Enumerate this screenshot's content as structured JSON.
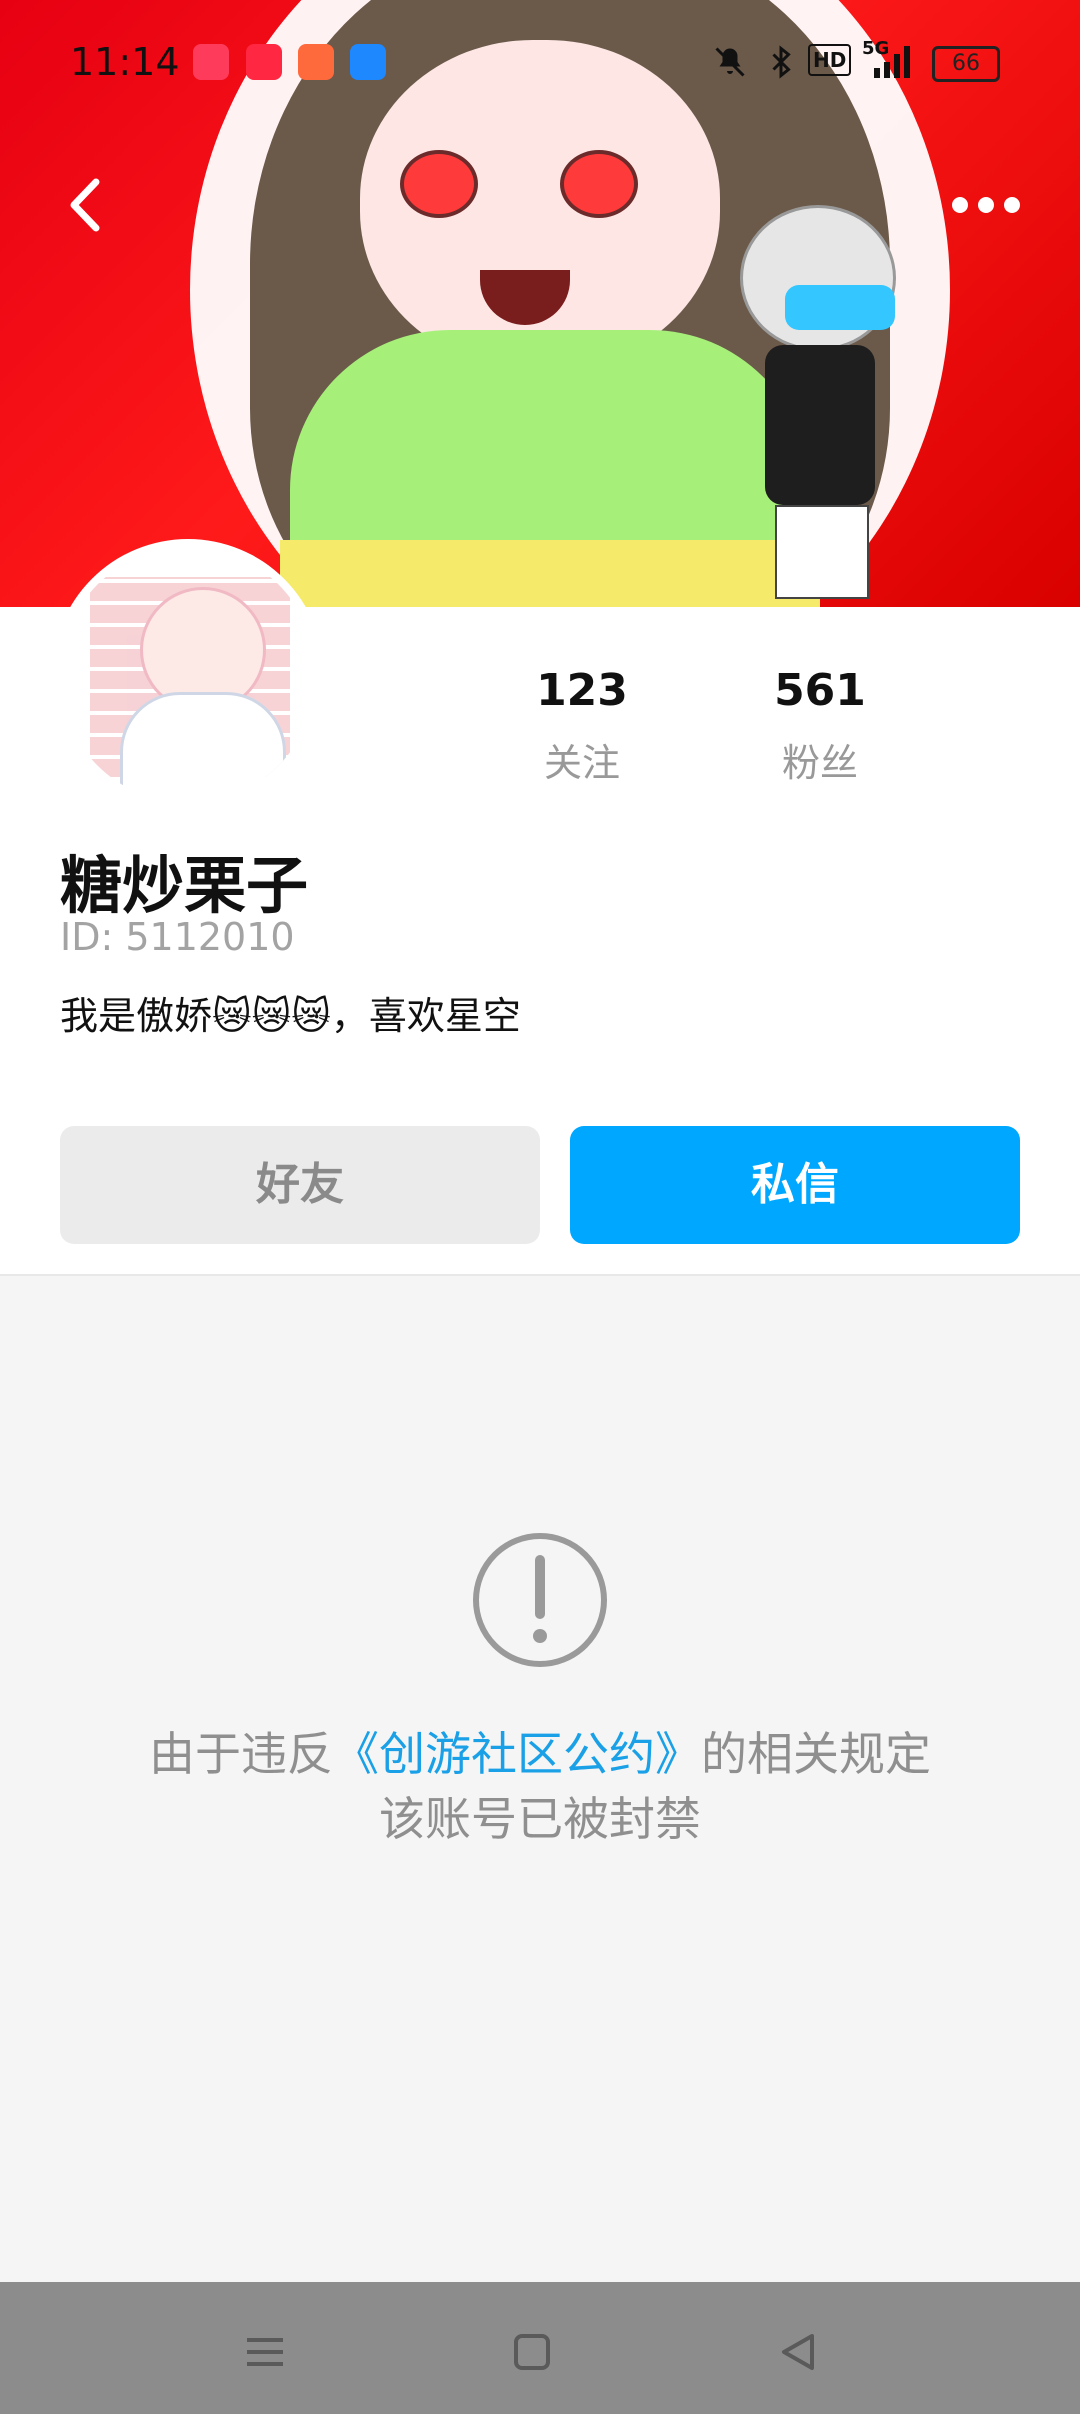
{
  "status_bar": {
    "time": "11:14",
    "network": "5G",
    "hd_label": "HD",
    "battery": "66",
    "notification_apps": [
      {
        "icon": "video-app-icon",
        "color": "#ff3b5c"
      },
      {
        "icon": "heart-app-icon",
        "color": "#ff2741"
      },
      {
        "icon": "game-app-icon",
        "color": "#ff6a3d"
      },
      {
        "icon": "files-app-icon",
        "color": "#1e88ff"
      }
    ]
  },
  "header": {
    "back_icon": "chevron-left-icon",
    "more_icon": "more-horizontal-icon"
  },
  "profile": {
    "stats": {
      "following_count": "123",
      "following_label": "关注",
      "followers_count": "561",
      "followers_label": "粉丝"
    },
    "name": "糖炒栗子",
    "id_text": "ID: 5112010",
    "bio": "我是傲娇😿😿😿，喜欢星空"
  },
  "actions": {
    "friend_label": "好友",
    "message_label": "私信"
  },
  "ban_notice": {
    "icon": "exclamation-circle-icon",
    "line1_prefix": "由于违反",
    "line1_link": "《创游社区公约》",
    "line1_suffix": "的相关规定",
    "line2": "该账号已被封禁"
  },
  "colors": {
    "accent": "#00a7ff",
    "link": "#1aa0e6",
    "banner_red": "#e60012",
    "nav_bg": "#8c8c8c"
  },
  "navigation_bar": {
    "icons": [
      "menu-icon",
      "home-square-icon",
      "back-triangle-icon"
    ]
  }
}
